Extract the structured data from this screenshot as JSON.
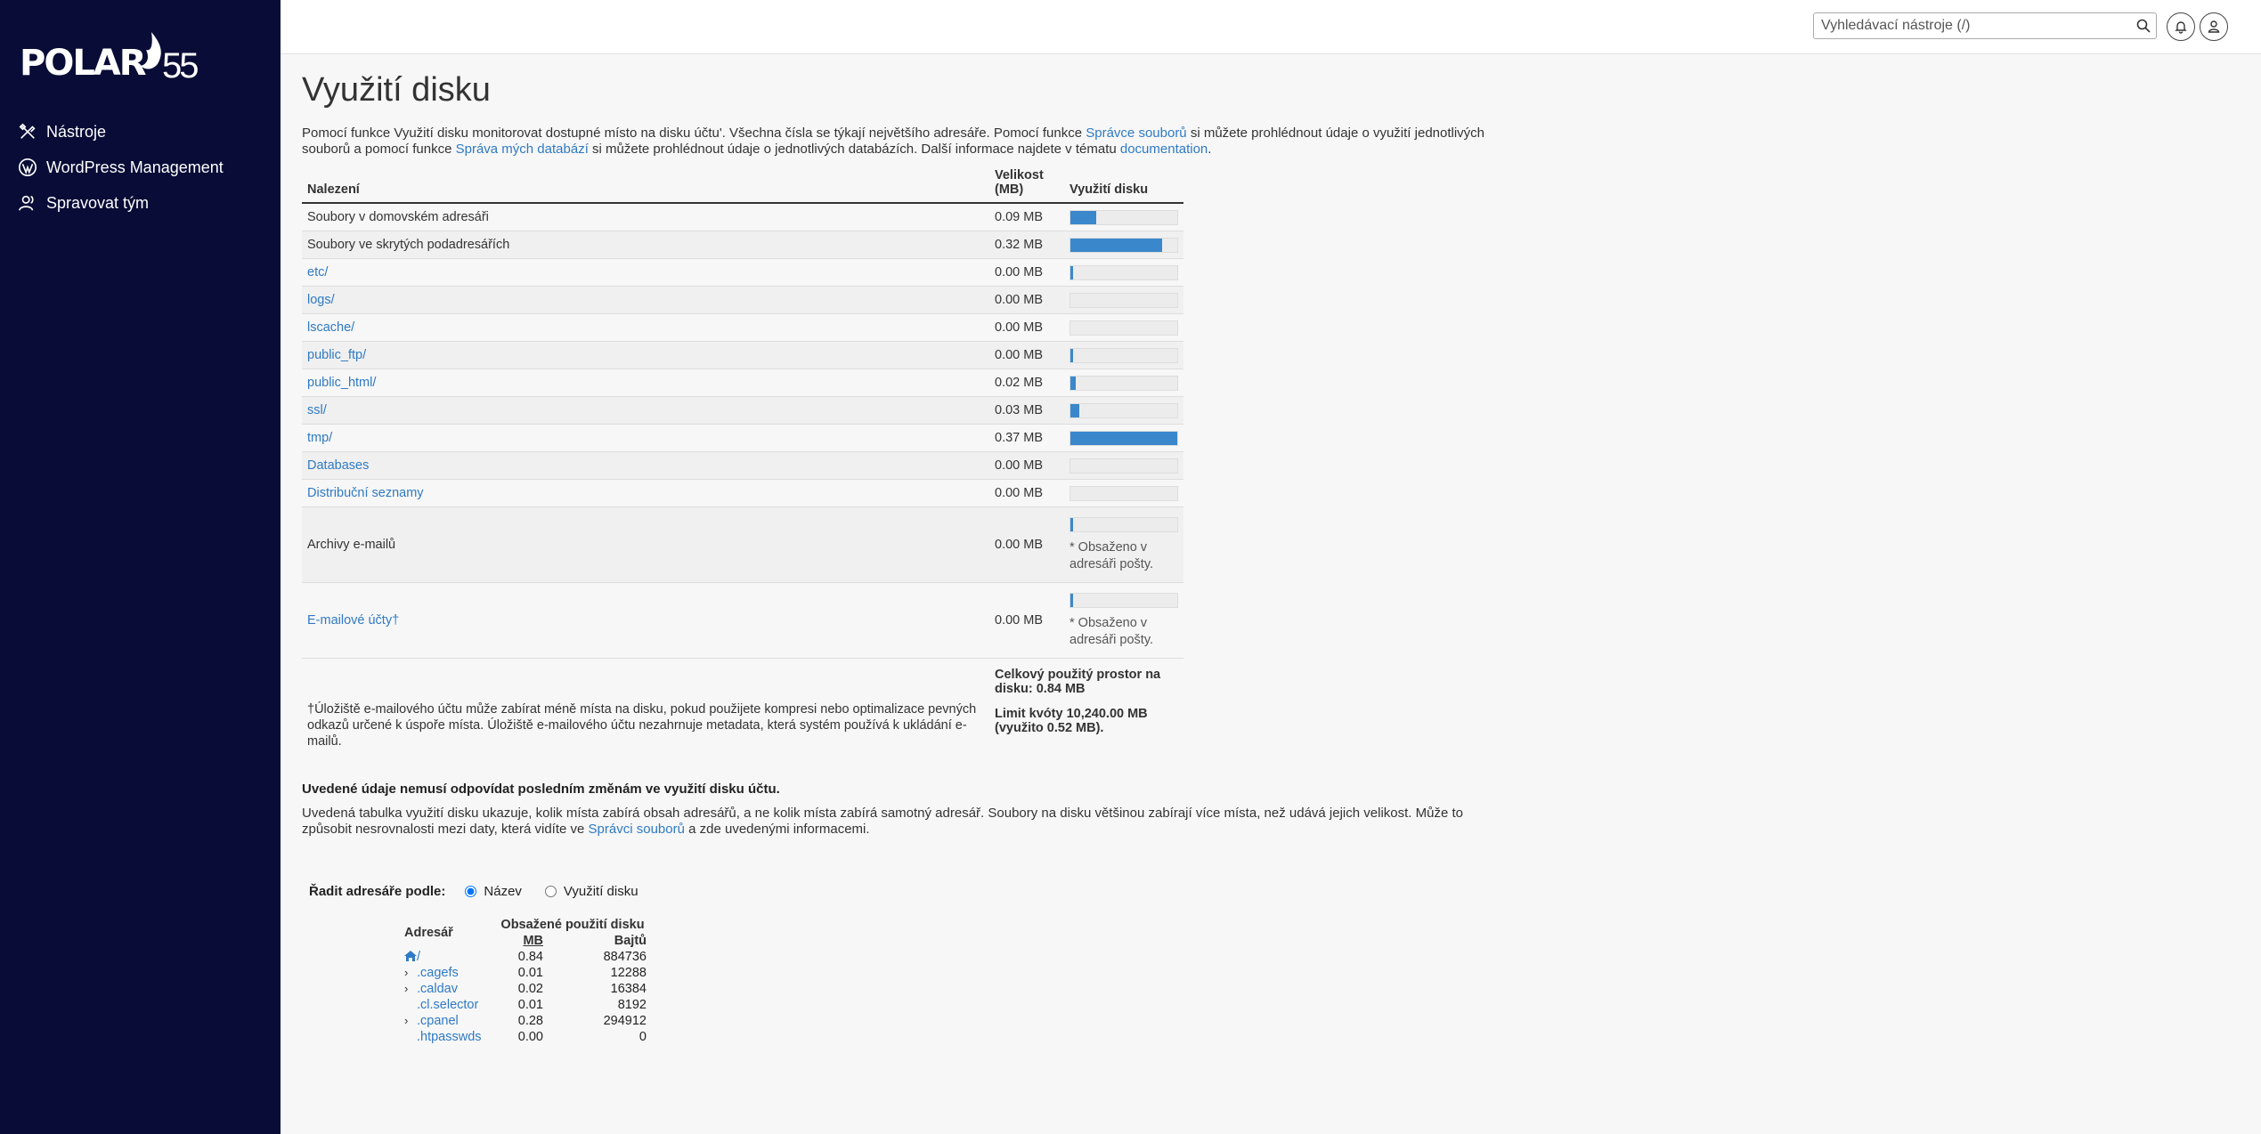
{
  "brand": {
    "logo_text": "POLAR",
    "logo_num": "55"
  },
  "sidebar": {
    "items": [
      {
        "label": "Nástroje",
        "icon": "tools-icon"
      },
      {
        "label": "WordPress Management",
        "icon": "wordpress-icon"
      },
      {
        "label": "Spravovat tým",
        "icon": "team-icon"
      }
    ]
  },
  "topbar": {
    "search_placeholder": "Vyhledávací nástroje (/)"
  },
  "page": {
    "title": "Využití disku",
    "intro_1": "Pomocí funkce Využití disku monitorovat dostupné místo na disku účtu'. Všechna čísla se týkají největšího adresáře. Pomocí funkce ",
    "intro_link_1": "Správce souborů",
    "intro_2": " si můžete prohlédnout údaje o využití jednotlivých souborů a pomocí funkce ",
    "intro_link_2": "Správa mých databází",
    "intro_3": " si můžete prohlédnout údaje o jednotlivých databázích. Další informace najdete v tématu ",
    "intro_link_3": "documentation",
    "intro_4": "."
  },
  "usage_table": {
    "col_location": "Nalezení",
    "col_size": "Velikost (MB)",
    "col_usage": "Využití disku",
    "rows": [
      {
        "name": "Soubory v domovském adresáři",
        "size": "0.09 MB",
        "usage": 0.24,
        "link": false
      },
      {
        "name": "Soubory ve skrytých podadresářích",
        "size": "0.32 MB",
        "usage": 0.86,
        "link": false
      },
      {
        "name": "etc/",
        "size": "0.00 MB",
        "usage": 0.01,
        "link": true
      },
      {
        "name": "logs/",
        "size": "0.00 MB",
        "usage": 0.0,
        "link": true
      },
      {
        "name": "lscache/",
        "size": "0.00 MB",
        "usage": 0.0,
        "link": true
      },
      {
        "name": "public_ftp/",
        "size": "0.00 MB",
        "usage": 0.01,
        "link": true
      },
      {
        "name": "public_html/",
        "size": "0.02 MB",
        "usage": 0.05,
        "link": true
      },
      {
        "name": "ssl/",
        "size": "0.03 MB",
        "usage": 0.08,
        "link": true
      },
      {
        "name": "tmp/",
        "size": "0.37 MB",
        "usage": 1.0,
        "link": true
      },
      {
        "name": "Databases",
        "size": "0.00 MB",
        "usage": 0.0,
        "link": true
      },
      {
        "name": "Distribuční seznamy",
        "size": "0.00 MB",
        "usage": 0.0,
        "link": true
      },
      {
        "name": "Archivy e-mailů",
        "size": "0.00 MB",
        "usage": 0.01,
        "link": false,
        "note": "* Obsaženo v adresáři pošty."
      },
      {
        "name": "E-mailové účty†",
        "size": "0.00 MB",
        "usage": 0.01,
        "link": true,
        "note": "* Obsaženo v adresáři pošty."
      }
    ],
    "total": "Celkový použitý prostor na disku: 0.84 MB",
    "quota": "Limit kvóty 10,240.00 MB (využito 0.52 MB).",
    "footnote": "†Úložiště e-mailového účtu může zabírat méně místa na disku, pokud použijete kompresi nebo optimalizace pevných odkazů určené k úspoře místa. Úložiště e-mailového účtu nezahrnuje metadata, která systém používá k ukládání e-mailů."
  },
  "warning": {
    "title": "Uvedené údaje nemusí odpovídat posledním změnám ve využití disku účtu.",
    "text_1": "Uvedená tabulka využití disku ukazuje, kolik místa zabírá obsah adresářů, a ne kolik místa zabírá samotný adresář. Soubory na disku většinou zabírají více místa, než udává jejich velikost. Může to způsobit nesrovnalosti mezi daty, která vidíte ve ",
    "link": "Správci souborů",
    "text_2": " a zde uvedenými informacemi."
  },
  "sort": {
    "label": "Řadit adresáře podle:",
    "option_name": "Název",
    "option_usage": "Využití disku",
    "selected": "name"
  },
  "dir_table": {
    "col_dir": "Adresář",
    "col_usage": "Obsažené použití disku",
    "col_mb": "MB",
    "col_bytes": "Bajtů",
    "rows": [
      {
        "name": "/",
        "mb": "0.84",
        "bytes": "884736",
        "home": true,
        "expand": false
      },
      {
        "name": ".cagefs",
        "mb": "0.01",
        "bytes": "12288",
        "expand": true
      },
      {
        "name": ".caldav",
        "mb": "0.02",
        "bytes": "16384",
        "expand": true
      },
      {
        "name": ".cl.selector",
        "mb": "0.01",
        "bytes": "8192",
        "expand": false
      },
      {
        "name": ".cpanel",
        "mb": "0.28",
        "bytes": "294912",
        "expand": true
      },
      {
        "name": ".htpasswds",
        "mb": "0.00",
        "bytes": "0",
        "expand": false
      }
    ]
  },
  "colors": {
    "sidebar_bg": "#080c36",
    "accent": "#3a87cb",
    "link": "#2f7ac4"
  }
}
